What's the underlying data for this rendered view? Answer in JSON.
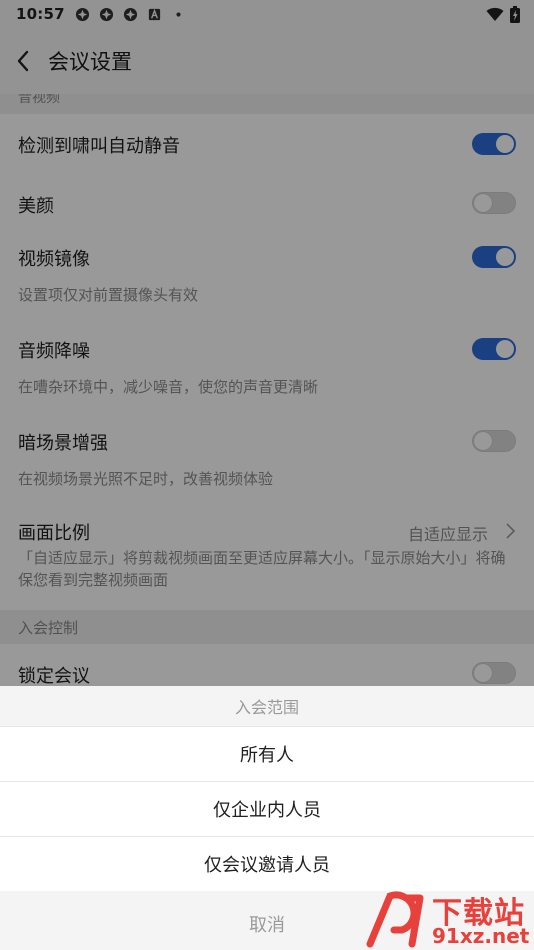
{
  "status_bar": {
    "time": "10:57",
    "icons": [
      "pinwheel-icon",
      "pinwheel-icon",
      "pinwheel-icon",
      "a-box-icon",
      "dot-icon"
    ],
    "right_icons": [
      "wifi-icon",
      "battery-icon"
    ]
  },
  "nav": {
    "title": "会议设置"
  },
  "sections": {
    "video_header_partial": "音视频",
    "rows": {
      "howling": {
        "label": "检测到啸叫自动静音",
        "on": true
      },
      "beauty": {
        "label": "美颜",
        "on": false
      },
      "mirror": {
        "label": "视频镜像",
        "on": true,
        "desc": "设置项仅对前置摄像头有效"
      },
      "denoise": {
        "label": "音频降噪",
        "on": true,
        "desc": "在嘈杂环境中，减少噪音，使您的声音更清晰"
      },
      "lowlight": {
        "label": "暗场景增强",
        "on": false,
        "desc": "在视频场景光照不足时，改善视频体验"
      },
      "aspect": {
        "label": "画面比例",
        "value": "自适应显示",
        "desc": "「自适应显示」将剪裁视频画面至更适应屏幕大小。「显示原始大小」将确保您看到完整视频画面"
      }
    },
    "join_control_header": "入会控制",
    "lock": {
      "label": "锁定会议",
      "on": false
    }
  },
  "sheet": {
    "title": "入会范围",
    "options": [
      "所有人",
      "仅企业内人员",
      "仅会议邀请人员"
    ],
    "cancel": "取消"
  },
  "watermark": {
    "brand": "下载站",
    "site": "91xz.net"
  },
  "colors": {
    "accent": "#2c6bd9",
    "watermark": "#e8413c"
  }
}
